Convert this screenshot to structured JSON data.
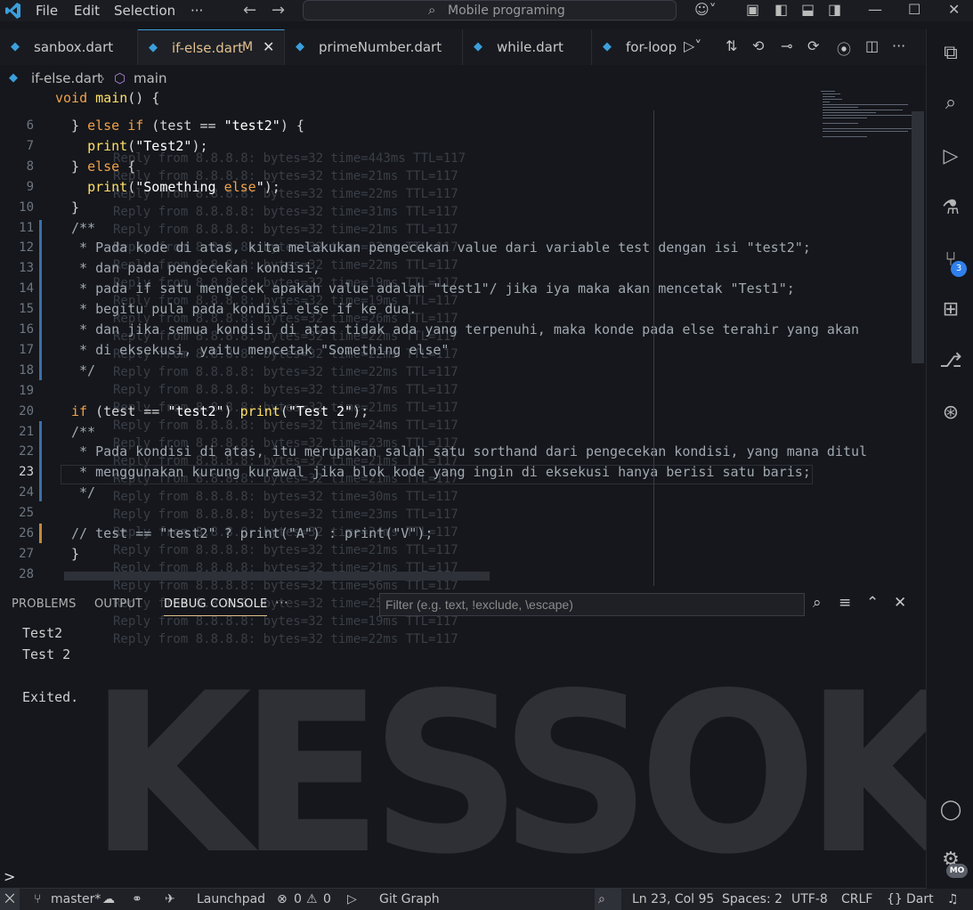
{
  "titlebar": {
    "menu": [
      "File",
      "Edit",
      "Selection",
      "···"
    ],
    "search": "Mobile programing"
  },
  "tabs": [
    {
      "label": "sanbox.dart",
      "active": false
    },
    {
      "label": "if-else.dart",
      "active": true,
      "modified": "M"
    },
    {
      "label": "primeNumber.dart",
      "active": false
    },
    {
      "label": "while.dart",
      "active": false
    },
    {
      "label": "for-loop",
      "active": false
    }
  ],
  "breadcrumb": {
    "file": "if-else.dart",
    "symbol": "main"
  },
  "editor": {
    "lines": [
      {
        "n": "6",
        "text": "} else if (test == \"test2\") {"
      },
      {
        "n": "7",
        "text": "  print(\"Test2\");"
      },
      {
        "n": "8",
        "text": "} else {"
      },
      {
        "n": "9",
        "text": "  print(\"Something else\");"
      },
      {
        "n": "10",
        "text": "}"
      },
      {
        "n": "11",
        "text": "/**"
      },
      {
        "n": "12",
        "text": " * Pada kode di atas, kita melakukan pengecekan value dari variable test dengan isi \"test2\";"
      },
      {
        "n": "13",
        "text": " * dan pada pengecekan kondisi,"
      },
      {
        "n": "14",
        "text": " * pada if satu mengecek apakah value adalah \"test1\"/ jika iya maka akan mencetak \"Test1\";"
      },
      {
        "n": "15",
        "text": " * begitu pula pada kondisi else if ke dua."
      },
      {
        "n": "16",
        "text": " * dan jika semua kondisi di atas tidak ada yang terpenuhi, maka konde pada else terahir yang akan"
      },
      {
        "n": "17",
        "text": " * di eksekusi, yaitu mencetak \"Something else\""
      },
      {
        "n": "18",
        "text": " */"
      },
      {
        "n": "19",
        "text": ""
      },
      {
        "n": "20",
        "text": "if (test == \"test2\") print(\"Test 2\");"
      },
      {
        "n": "21",
        "text": "/**"
      },
      {
        "n": "22",
        "text": " * Pada kondisi di atas, itu merupakan salah satu sorthand dari pengecekan kondisi, yang mana ditul"
      },
      {
        "n": "23",
        "text": " * menggunakan kurung kurawal jika blok kode yang ingin di eksekusi hanya berisi satu baris;"
      },
      {
        "n": "24",
        "text": " */"
      },
      {
        "n": "25",
        "text": ""
      },
      {
        "n": "26",
        "text": "// test == \"test2\" ? print(\"A\") : print(\"V\");"
      },
      {
        "n": "27",
        "text": "}"
      },
      {
        "n": "28",
        "text": ""
      }
    ],
    "first_line": "void main() {",
    "ghost_lines": [
      "Reply from 8.8.8.8: bytes=32 time=443ms TTL=117",
      "Reply from 8.8.8.8: bytes=32 time=21ms TTL=117",
      "Reply from 8.8.8.8: bytes=32 time=22ms TTL=117",
      "Reply from 8.8.8.8: bytes=32 time=31ms TTL=117",
      "Reply from 8.8.8.8: bytes=32 time=21ms TTL=117",
      "Reply from 8.8.8.8: bytes=32 time=22ms TTL=117",
      "Reply from 8.8.8.8: bytes=32 time=22ms TTL=117",
      "Reply from 8.8.8.8: bytes=32 time=19ms TTL=117",
      "Reply from 8.8.8.8: bytes=32 time=19ms TTL=117",
      "Reply from 8.8.8.8: bytes=32 time=26ms TTL=117",
      "Reply from 8.8.8.8: bytes=32 time=22ms TTL=117",
      "Reply from 8.8.8.8: bytes=32 time=22ms TTL=117",
      "Reply from 8.8.8.8: bytes=32 time=22ms TTL=117",
      "Reply from 8.8.8.8: bytes=32 time=37ms TTL=117",
      "Reply from 8.8.8.8: bytes=32 time=21ms TTL=117",
      "Reply from 8.8.8.8: bytes=32 time=24ms TTL=117",
      "Reply from 8.8.8.8: bytes=32 time=23ms TTL=117",
      "Reply from 8.8.8.8: bytes=32 time=21ms TTL=117",
      "Reply from 8.8.8.8: bytes=32 time=21ms TTL=117",
      "Reply from 8.8.8.8: bytes=32 time=30ms TTL=117",
      "Reply from 8.8.8.8: bytes=32 time=23ms TTL=117",
      "Reply from 8.8.8.8: bytes=32 time=24ms TTL=117",
      "Reply from 8.8.8.8: bytes=32 time=21ms TTL=117",
      "Reply from 8.8.8.8: bytes=32 time=21ms TTL=117",
      "Reply from 8.8.8.8: bytes=32 time=56ms TTL=117",
      "Reply from 8.8.8.8: bytes=32 time=25ms TTL=117",
      "Reply from 8.8.8.8: bytes=32 time=19ms TTL=117",
      "Reply from 8.8.8.8: bytes=32 time=22ms TTL=117"
    ]
  },
  "panel": {
    "tabs": [
      "PROBLEMS",
      "OUTPUT",
      "DEBUG CONSOLE"
    ],
    "more": "···",
    "filter_placeholder": "Filter (e.g. text, !exclude, \\escape)",
    "output": [
      "Test2",
      "Test 2",
      "",
      "Exited."
    ],
    "prompt": ">"
  },
  "activity": {
    "scm_badge": "3",
    "account_badge": "MO"
  },
  "background_word": "KESSOKU",
  "statusbar": {
    "branch": "master*",
    "launchpad": "Launchpad",
    "errors": "0",
    "warnings": "0",
    "git_graph": "Git Graph",
    "position": "Ln 23, Col 95",
    "spaces": "Spaces: 2",
    "encoding": "UTF-8",
    "eol": "CRLF",
    "language": "Dart"
  },
  "colors": {
    "accent": "#3b9fdc",
    "modified": "#e2c08d",
    "keyword": "#f0a14a",
    "function": "#ffe066",
    "badge": "#2f80ed"
  }
}
